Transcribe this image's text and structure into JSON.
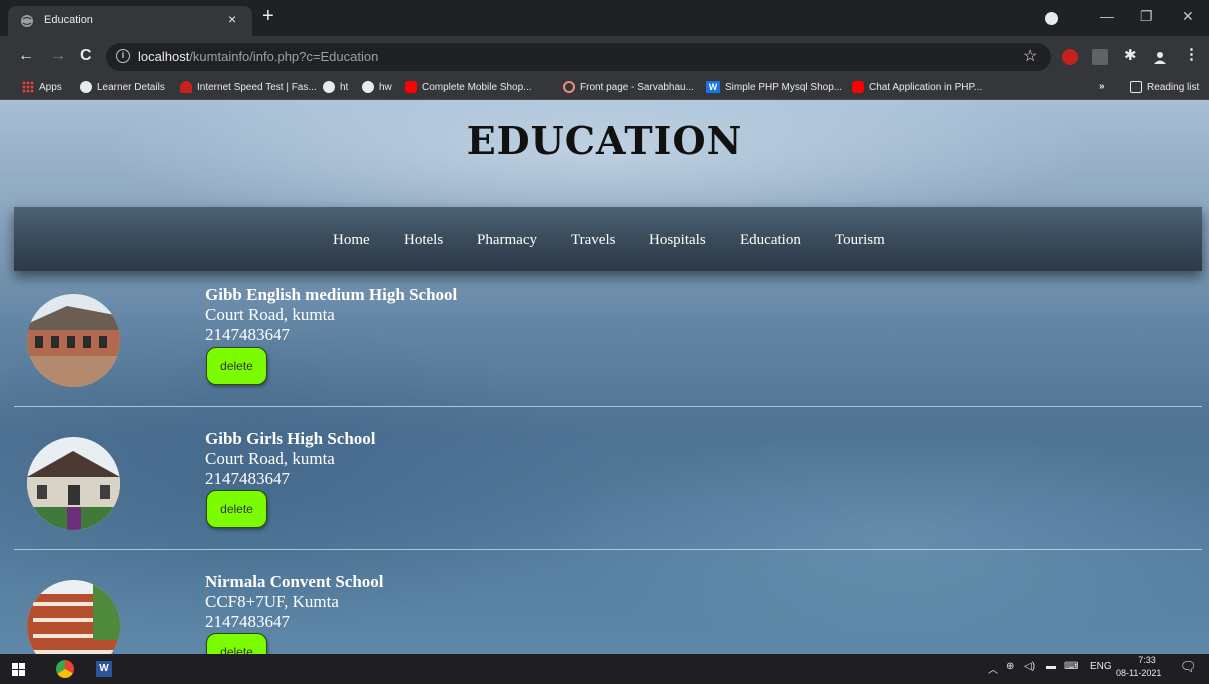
{
  "browser": {
    "tab_title": "Education",
    "tab_close": "×",
    "new_tab": "+",
    "url_host": "localhost",
    "url_path": "/kumtainfo/info.php?c=Education",
    "window_controls": {
      "minimize": "—",
      "restore": "❐",
      "close": "✕"
    }
  },
  "bookmarks": {
    "items": [
      {
        "label": "Apps",
        "icon": "apps-grid-icon"
      },
      {
        "label": "Learner Details",
        "icon": "globe-icon"
      },
      {
        "label": "Internet Speed Test | Fas...",
        "icon": "speedtest-icon"
      },
      {
        "label": "ht",
        "icon": "globe-icon"
      },
      {
        "label": "hw",
        "icon": "globe-icon"
      },
      {
        "label": "Complete Mobile Shop...",
        "icon": "youtube-icon"
      },
      {
        "label": "Front page - Sarvabhau...",
        "icon": "site-icon"
      },
      {
        "label": "Simple PHP Mysql Shop...",
        "icon": "w-icon"
      },
      {
        "label": "Chat Application in PHP...",
        "icon": "youtube-icon"
      }
    ],
    "overflow": "»",
    "reading_list": "Reading list"
  },
  "page": {
    "title": "EDUCATION",
    "nav": [
      "Home",
      "Hotels",
      "Pharmacy",
      "Travels",
      "Hospitals",
      "Education",
      "Tourism"
    ],
    "listings": [
      {
        "name": "Gibb English medium High School",
        "address": "Court Road, kumta",
        "phone": "2147483647",
        "button": "delete"
      },
      {
        "name": "Gibb Girls High School",
        "address": "Court Road, kumta",
        "phone": "2147483647",
        "button": "delete"
      },
      {
        "name": "Nirmala Convent School",
        "address": "CCF8+7UF, Kumta",
        "phone": "2147483647",
        "button": "delete"
      }
    ]
  },
  "taskbar": {
    "language": "ENG",
    "time": "7:33",
    "date": "08-11-2021"
  },
  "colors": {
    "delete_button": "#7cfc00",
    "navbar": "#3a4b5a",
    "chrome_dark": "#202124",
    "chrome_mid": "#35363a"
  }
}
